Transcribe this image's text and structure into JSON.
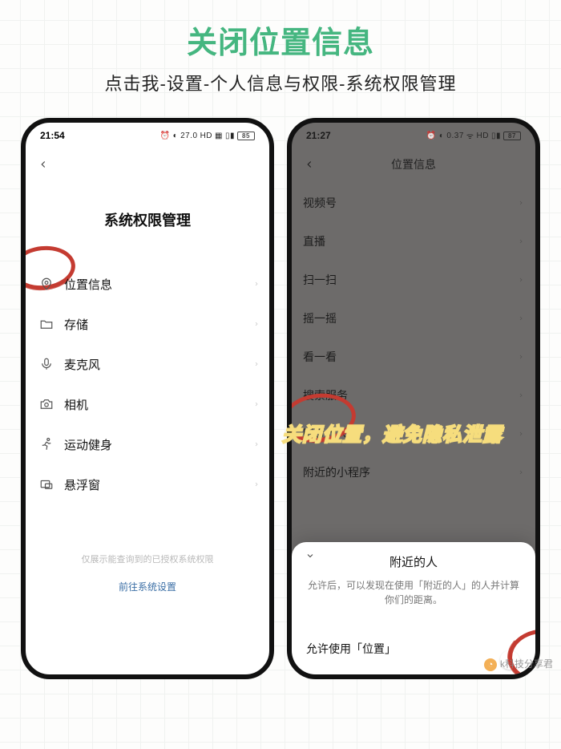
{
  "header": {
    "title": "关闭位置信息",
    "subtitle": "点击我-设置-个人信息与权限-系统权限管理"
  },
  "left_phone": {
    "status": {
      "time": "21:54",
      "battery": "85"
    },
    "page_title": "系统权限管理",
    "items": [
      {
        "icon": "location-pin-icon",
        "label": "位置信息"
      },
      {
        "icon": "folder-icon",
        "label": "存储"
      },
      {
        "icon": "mic-icon",
        "label": "麦克风"
      },
      {
        "icon": "camera-icon",
        "label": "相机"
      },
      {
        "icon": "run-icon",
        "label": "运动健身"
      },
      {
        "icon": "window-icon",
        "label": "悬浮窗"
      }
    ],
    "hint": "仅展示能查询到的已授权系统权限",
    "goto": "前往系统设置"
  },
  "right_phone": {
    "status": {
      "time": "21:27",
      "battery": "87"
    },
    "page_title": "位置信息",
    "items": [
      "视频号",
      "直播",
      "扫一扫",
      "摇一摇",
      "看一看",
      "搜索服务",
      "附近的人",
      "附近的小程序"
    ],
    "sheet": {
      "title": "附近的人",
      "desc": "允许后，可以发现在使用「附近的人」的人并计算你们的距离。",
      "toggle_label": "允许使用「位置」",
      "toggle_on": true
    }
  },
  "caption": "关闭位置，避免隐私泄露",
  "watermark": "k科技分享君"
}
